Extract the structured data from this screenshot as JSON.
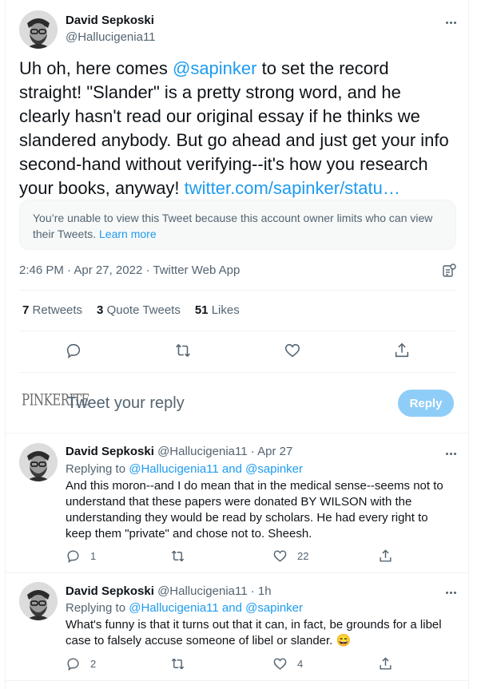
{
  "main_tweet": {
    "author_name": "David Sepkoski",
    "author_handle": "@Hallucigenia11",
    "text_before_mention": "Uh oh, here comes ",
    "mention": "@sapinker",
    "text_after_mention": " to set the record straight! \"Slander\" is a pretty strong word, and he clearly hasn't read our original essay if he thinks we slandered anybody. But go ahead and just get your info second-hand without verifying--it's how you research your books, anyway! ",
    "link_text": "twitter.com/sapinker/statu…",
    "quoted_notice": "You’re unable to view this Tweet because this account owner limits who can view their Tweets.",
    "learn_more": "Learn more",
    "time": "2:46 PM",
    "date": "Apr 27, 2022",
    "source": "Twitter Web App",
    "separator": "·",
    "retweets_count": "7",
    "retweets_label": "Retweets",
    "quote_count": "3",
    "quote_label": "Quote Tweets",
    "likes_count": "51",
    "likes_label": "Likes"
  },
  "reply_composer": {
    "avatar_text": "PINKERITE",
    "placeholder": "Tweet your reply",
    "button_label": "Reply"
  },
  "replies": [
    {
      "author_name": "David Sepkoski",
      "author_handle": "@Hallucigenia11",
      "time": "Apr 27",
      "replying_prefix": "Replying to ",
      "replying_targets": "@Hallucigenia11 and @sapinker",
      "text": "And this moron--and I do mean that in the medical sense--seems not to understand that these papers were donated BY WILSON with the understanding they would be read by scholars. He had every right to keep them \"private\" and chose not to. Sheesh.",
      "reply_count": "1",
      "retweet_count": "",
      "like_count": "22"
    },
    {
      "author_name": "David Sepkoski",
      "author_handle": "@Hallucigenia11",
      "time": "1h",
      "replying_prefix": "Replying to ",
      "replying_targets": "@Hallucigenia11 and @sapinker",
      "text": "What's funny is that it turns out that it can, in fact, be grounds for a libel case to falsely accuse someone of libel or slander. 😄",
      "reply_count": "2",
      "retweet_count": "",
      "like_count": "4"
    }
  ],
  "colors": {
    "accent": "#1d9bf0",
    "secondary_text": "#536471",
    "border": "#eff3f4",
    "reply_button_disabled": "#8ecdf8"
  },
  "icons": [
    "more-icon",
    "reply-icon",
    "retweet-icon",
    "like-icon",
    "share-icon",
    "analytics-icon"
  ]
}
